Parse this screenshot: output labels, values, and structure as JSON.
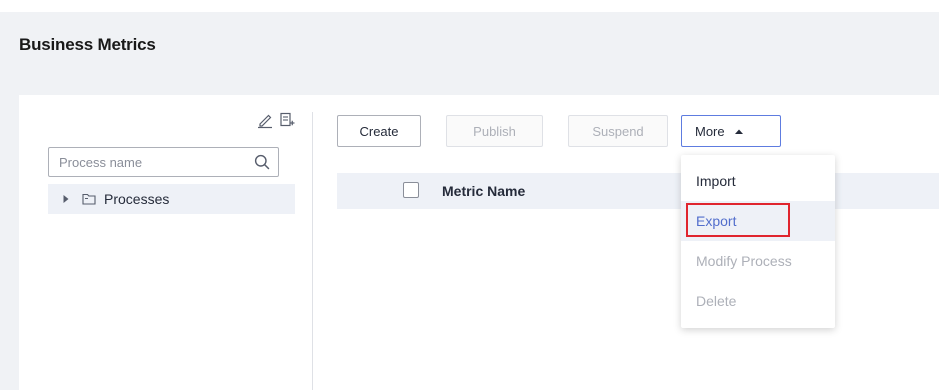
{
  "page": {
    "title": "Business Metrics"
  },
  "tree": {
    "search_placeholder": "Process name",
    "nodes": [
      {
        "label": "Processes",
        "expanded": false
      }
    ],
    "tools": [
      "edit-icon",
      "add-folder-icon"
    ]
  },
  "toolbar": {
    "create_label": "Create",
    "publish_label": "Publish",
    "suspend_label": "Suspend",
    "more_label": "More"
  },
  "table": {
    "columns": [
      "Metric Name"
    ]
  },
  "more_menu": {
    "items": [
      {
        "label": "Import",
        "disabled": false
      },
      {
        "label": "Export",
        "disabled": false,
        "highlighted": true
      },
      {
        "label": "Modify Process",
        "disabled": true
      },
      {
        "label": "Delete",
        "disabled": true
      }
    ]
  },
  "colors": {
    "accent": "#5e7ce0",
    "highlight_border": "#e0252e",
    "disabled_text": "#adb0b8"
  }
}
